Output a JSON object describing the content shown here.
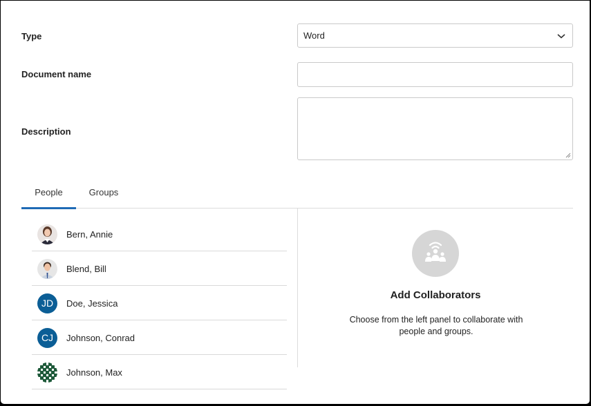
{
  "form": {
    "type_label": "Type",
    "type_value": "Word",
    "document_name_label": "Document name",
    "document_name_value": "",
    "description_label": "Description",
    "description_value": ""
  },
  "tabs": [
    {
      "label": "People",
      "active": true
    },
    {
      "label": "Groups",
      "active": false
    }
  ],
  "people": [
    {
      "name": "Bern, Annie",
      "avatar": "photo"
    },
    {
      "name": "Blend, Bill",
      "avatar": "photo"
    },
    {
      "name": "Doe, Jessica",
      "avatar": "initials",
      "initials": "JD"
    },
    {
      "name": "Johnson, Conrad",
      "avatar": "initials",
      "initials": "CJ"
    },
    {
      "name": "Johnson, Max",
      "avatar": "pattern"
    }
  ],
  "collaborators_panel": {
    "title": "Add Collaborators",
    "description": "Choose from the left panel to collaborate with people and groups."
  },
  "colors": {
    "accent": "#1f6ab5",
    "initials_avatar": "#0b5e96",
    "panel_icon_bg": "#d6d6d6"
  },
  "icons": {
    "select": "chevron-down-icon",
    "panel": "collaborators-icon"
  }
}
